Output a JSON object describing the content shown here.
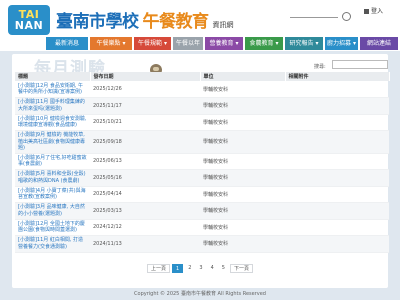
{
  "header": {
    "logo_top": "TAI",
    "logo_bottom": "NAN",
    "title_main": "臺南市學校",
    "title_accent": "午餐教育",
    "title_sub": "資訊網",
    "login_label": "登入"
  },
  "nav": [
    {
      "label": "最新消息",
      "color": "#2a8fc9"
    },
    {
      "label": "午餐樂點 ▾",
      "color": "#e4782e"
    },
    {
      "label": "午餐規範 ▾",
      "color": "#d64a3a"
    },
    {
      "label": "午餐以年",
      "color": "#9aa3ab"
    },
    {
      "label": "營養教育 ▾",
      "color": "#8b4aa6"
    },
    {
      "label": "食農教育 ▾",
      "color": "#3a9a4a"
    },
    {
      "label": "研究報告 ▾",
      "color": "#2f8a9a"
    },
    {
      "label": "廚力招募 ▾",
      "color": "#2a8fc9"
    },
    {
      "label": "網站連結",
      "color": "#6a4aa6"
    }
  ],
  "page": {
    "heading": "每月測驗",
    "search_label": "搜尋:"
  },
  "table": {
    "headers": [
      "標題",
      "發布日期",
      "單位",
      "相關附件"
    ],
    "rows": [
      {
        "title": "[小測驗]12月 食品安衛期, 午餐中的魚所小知識(宣導案例)",
        "date": "2025/12/26",
        "unit": "學輔校安科"
      },
      {
        "title": "[小測驗]11月 國手料理集練的大所來蛋吗(選題測)",
        "date": "2025/11/17",
        "unit": "學輔校安科"
      },
      {
        "title": "[小測驗]10月 健檢週食安測驗, 環境健康宣導觀(食品健康)",
        "date": "2025/10/21",
        "unit": "學輔校安科"
      },
      {
        "title": "[小測驗]9月 健檢的 機能牧草, 植出美高社區劇(食物與健康專題)",
        "date": "2025/09/18",
        "unit": "學輔校安科"
      },
      {
        "title": "[小測驗]6月了住宅,好吃甜蜜故事(食農劇)",
        "date": "2025/06/13",
        "unit": "學輔校安科"
      },
      {
        "title": "[小測驗]5月 喜料和全穀(全穀)唱歌的和熱與DNA (食農劇)",
        "date": "2025/05/16",
        "unit": "學輔校安科"
      },
      {
        "title": "[小測驗]4月 小寶丁菜(共)與海苔宣教(宣教案例)",
        "date": "2025/04/14",
        "unit": "學輔校安科"
      },
      {
        "title": "[小測驗]3月 品味健康, 大自然的小小營養(選題測)",
        "date": "2025/03/13",
        "unit": "學輔校安科"
      },
      {
        "title": "[小測驗]12月 全國土地下的慶團公園(食物與時間蓋選測)",
        "date": "2024/12/12",
        "unit": "學輔校安科"
      },
      {
        "title": "[小測驗]11月 紅白相間, 打造營養餐力(交食通測驗)",
        "date": "2024/11/13",
        "unit": "學輔校安科"
      }
    ]
  },
  "pagination": {
    "prev": "上一頁",
    "pages": [
      "1",
      "2",
      "3",
      "4",
      "5"
    ],
    "current": "1",
    "next": "下一頁"
  },
  "footer": {
    "text": "Copyright © 2025 臺南市午餐教育 All Rights Reserved"
  }
}
